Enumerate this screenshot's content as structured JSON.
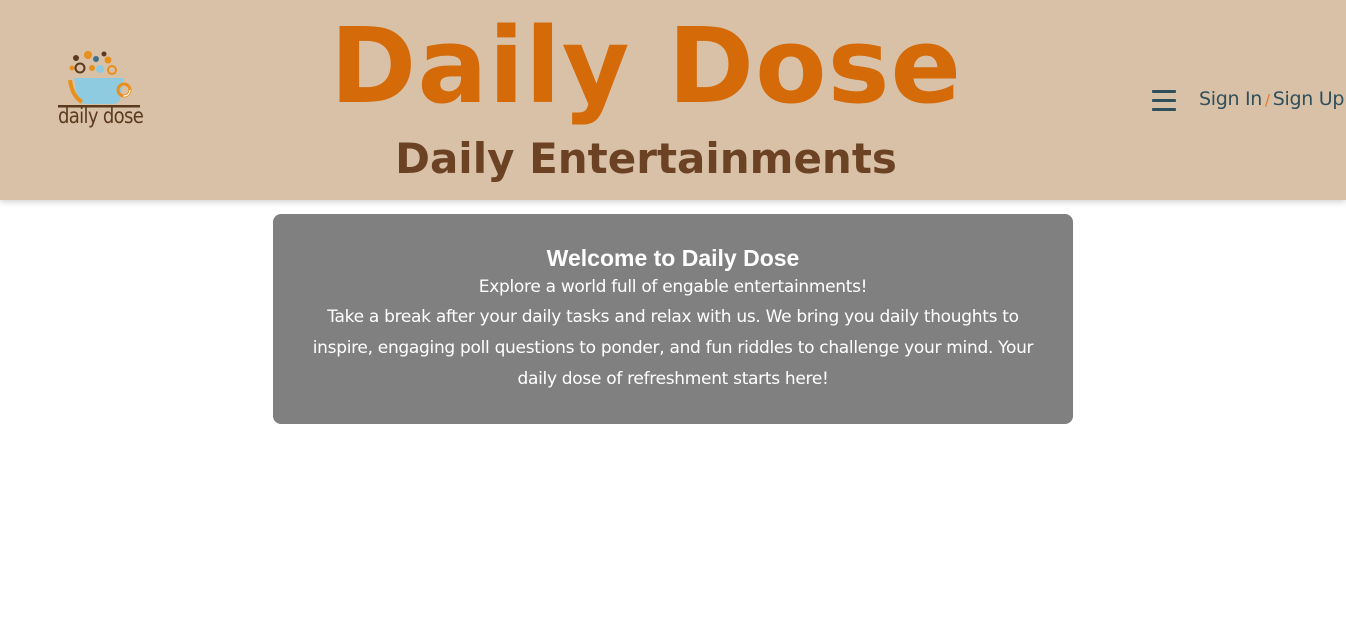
{
  "header": {
    "logo_text": "daily dose",
    "logo_icon": "coffee-cup-with-bubbles",
    "title": "Daily Dose",
    "subtitle": "Daily Entertainments",
    "menu_icon": "hamburger-menu",
    "sign_in_label": "Sign In",
    "separator": "/",
    "sign_up_label": "Sign Up"
  },
  "welcome": {
    "title": "Welcome to Daily Dose",
    "tagline": "Explore a world full of engable entertainments!",
    "body": "Take a break after your daily tasks and relax with us. We bring you daily thoughts to inspire, engaging poll questions to ponder, and fun riddles to challenge your mind. Your daily dose of refreshment starts here!"
  },
  "colors": {
    "header_bg": "#d9c1a8",
    "brand_orange": "#d46a08",
    "brand_brown": "#6b4324",
    "nav_text": "#2f4f5a",
    "card_bg": "#808080"
  }
}
